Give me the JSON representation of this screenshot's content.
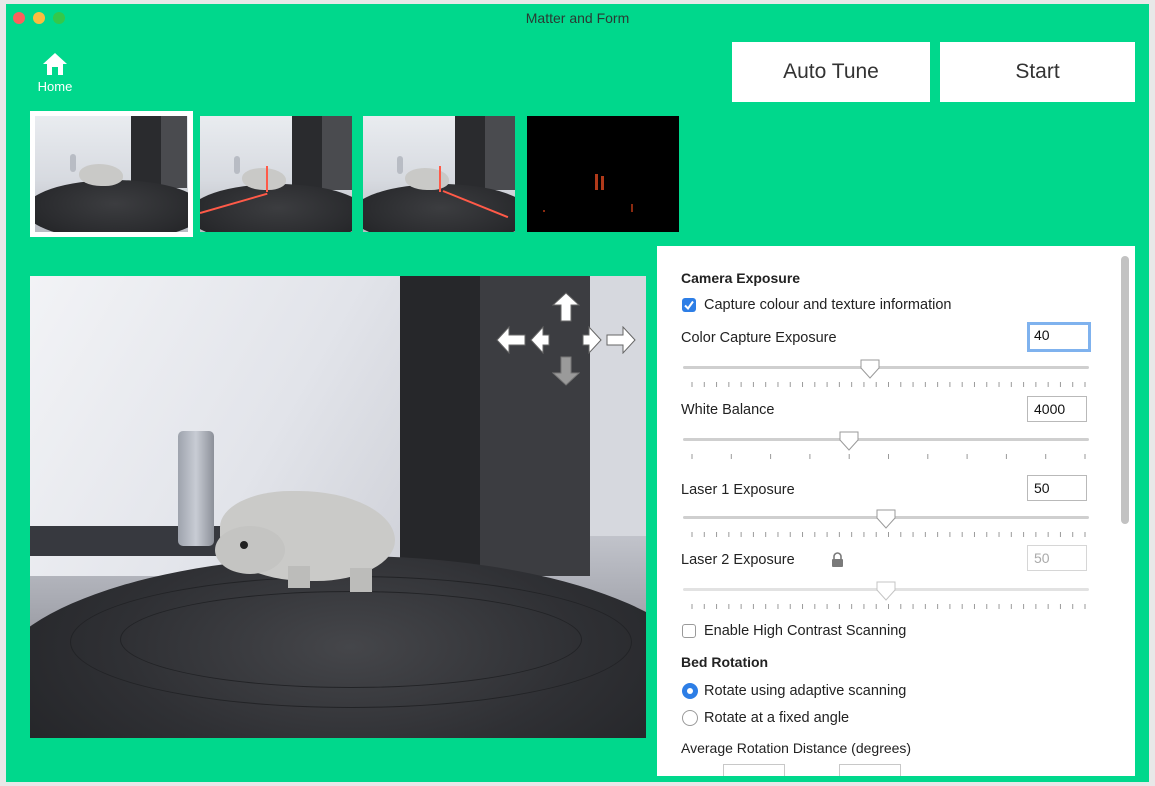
{
  "window": {
    "title": "Matter and Form"
  },
  "nav": {
    "home_label": "Home"
  },
  "toolbar": {
    "auto_tune_label": "Auto Tune",
    "start_label": "Start"
  },
  "thumbnails": [
    {
      "name": "color-view"
    },
    {
      "name": "laser-1-view"
    },
    {
      "name": "laser-2-view"
    },
    {
      "name": "laser-only-view"
    }
  ],
  "settings": {
    "camera_exposure": {
      "title": "Camera Exposure",
      "capture_colour": {
        "label": "Capture colour and texture information",
        "checked": true
      },
      "color_capture_exposure": {
        "label": "Color Capture Exposure",
        "value": "40",
        "slider_fraction": 0.46
      },
      "white_balance": {
        "label": "White Balance",
        "value": "4000",
        "slider_fraction": 0.41
      },
      "laser1_exposure": {
        "label": "Laser 1 Exposure",
        "value": "50",
        "slider_fraction": 0.5
      },
      "laser2_exposure": {
        "label": "Laser 2 Exposure",
        "value": "50",
        "slider_fraction": 0.5,
        "locked": true
      },
      "high_contrast": {
        "label": "Enable High Contrast Scanning",
        "checked": false
      }
    },
    "bed_rotation": {
      "title": "Bed Rotation",
      "options": [
        {
          "label": "Rotate using adaptive scanning",
          "selected": true
        },
        {
          "label": "Rotate at a fixed angle",
          "selected": false
        }
      ],
      "average_rotation_label": "Average Rotation Distance (degrees)"
    }
  },
  "colors": {
    "accent": "#00d88c",
    "selection": "#2d7ee6"
  }
}
